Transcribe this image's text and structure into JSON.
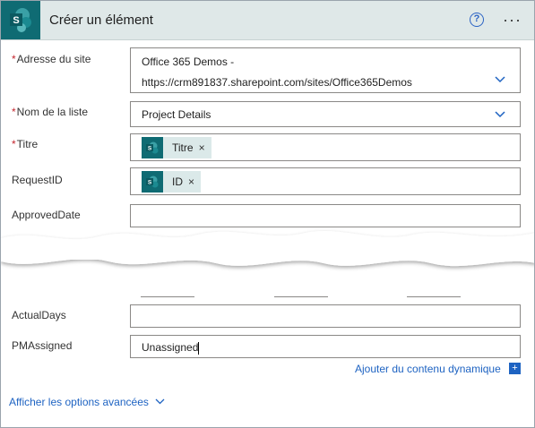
{
  "header": {
    "title": "Créer un élément",
    "logo_icon": "sharepoint-logo-icon",
    "help_icon": "help-icon",
    "help_glyph": "?",
    "more_icon": "more-options-icon",
    "more_glyph": "···"
  },
  "colors": {
    "header_bg": "#dfe8e8",
    "brand_teal": "#0f6b73",
    "token_bg": "#dbe9e9",
    "link_blue": "#1e63c2",
    "required_red": "#c4262e"
  },
  "fields": {
    "site": {
      "required_mark": "*",
      "label": "Adresse du site",
      "value_line1": "Office 365 Demos -",
      "value_line2": "https://crm891837.sharepoint.com/sites/Office365Demos"
    },
    "list": {
      "required_mark": "*",
      "label": "Nom de la liste",
      "value": "Project Details"
    },
    "titre": {
      "required_mark": "*",
      "label": "Titre",
      "token_label": "Titre",
      "token_close": "×"
    },
    "requestid": {
      "label": "RequestID",
      "token_label": "ID",
      "token_close": "×"
    },
    "approveddate": {
      "label": "ApprovedDate",
      "value": ""
    },
    "actualdays": {
      "label": "ActualDays",
      "value": ""
    },
    "pmassigned": {
      "label": "PMAssigned",
      "value": "Unassigned"
    }
  },
  "footer": {
    "dynamic_content_link": "Ajouter du contenu dynamique",
    "plus_glyph": "+",
    "advanced_options_link": "Afficher les options avancées"
  }
}
